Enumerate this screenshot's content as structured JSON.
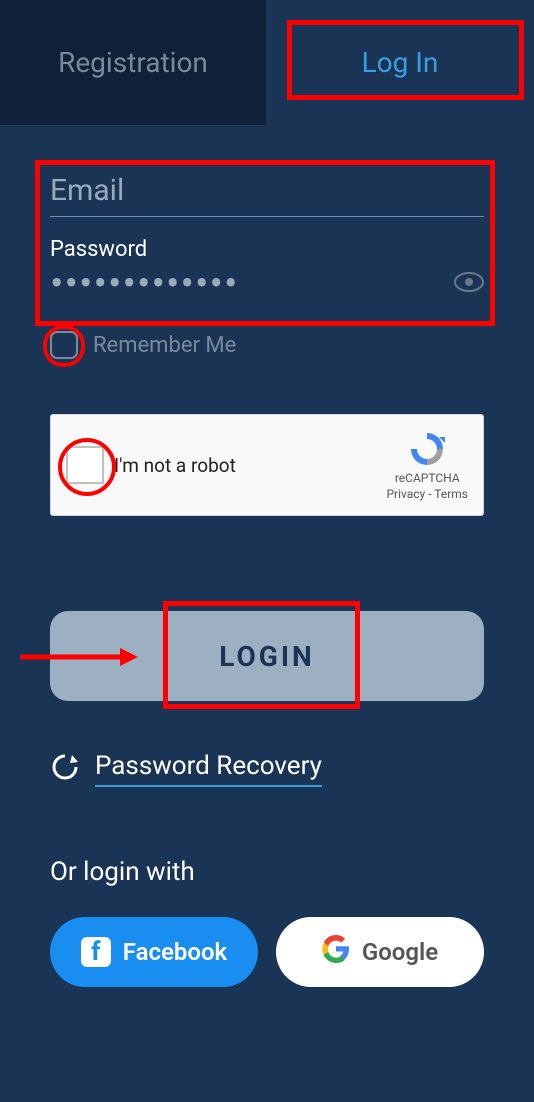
{
  "tabs": {
    "registration": "Registration",
    "login": "Log In"
  },
  "form": {
    "email_placeholder": "Email",
    "password_label": "Password",
    "password_value": "•••••••••••••",
    "remember_label": "Remember Me"
  },
  "recaptcha": {
    "text": "I'm not a robot",
    "brand": "reCAPTCHA",
    "links": "Privacy - Terms"
  },
  "actions": {
    "login_button": "LOGIN",
    "recovery": "Password Recovery",
    "or_label": "Or login with",
    "facebook": "Facebook",
    "google": "Google"
  }
}
